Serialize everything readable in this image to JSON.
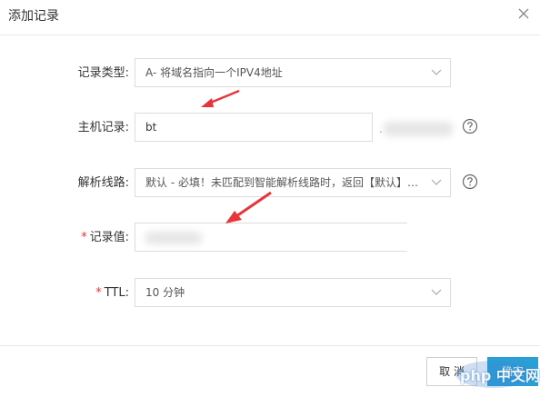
{
  "dialog": {
    "title": "添加记录"
  },
  "fields": {
    "record_type": {
      "label": "记录类型:",
      "value": "A- 将域名指向一个IPV4地址",
      "icon": "chevron-down-icon"
    },
    "host": {
      "label": "主机记录:",
      "value": "bt",
      "suffix": "."
    },
    "line": {
      "label": "解析线路:",
      "value": "默认 - 必填！未匹配到智能解析线路时，返回【默认】线路...",
      "icon": "chevron-down-icon"
    },
    "record_value": {
      "label": "记录值:",
      "required_mark": "*",
      "value": ""
    },
    "ttl": {
      "label": "TTL:",
      "required_mark": "*",
      "value": "10 分钟",
      "icon": "chevron-down-icon"
    }
  },
  "footer": {
    "cancel_label": "取 消",
    "ok_label": "确定"
  },
  "watermark": {
    "text": "php 中文网"
  },
  "colors": {
    "accent": "#2a9fd6",
    "required": "#e4393c",
    "annotation": "#e8343a"
  }
}
